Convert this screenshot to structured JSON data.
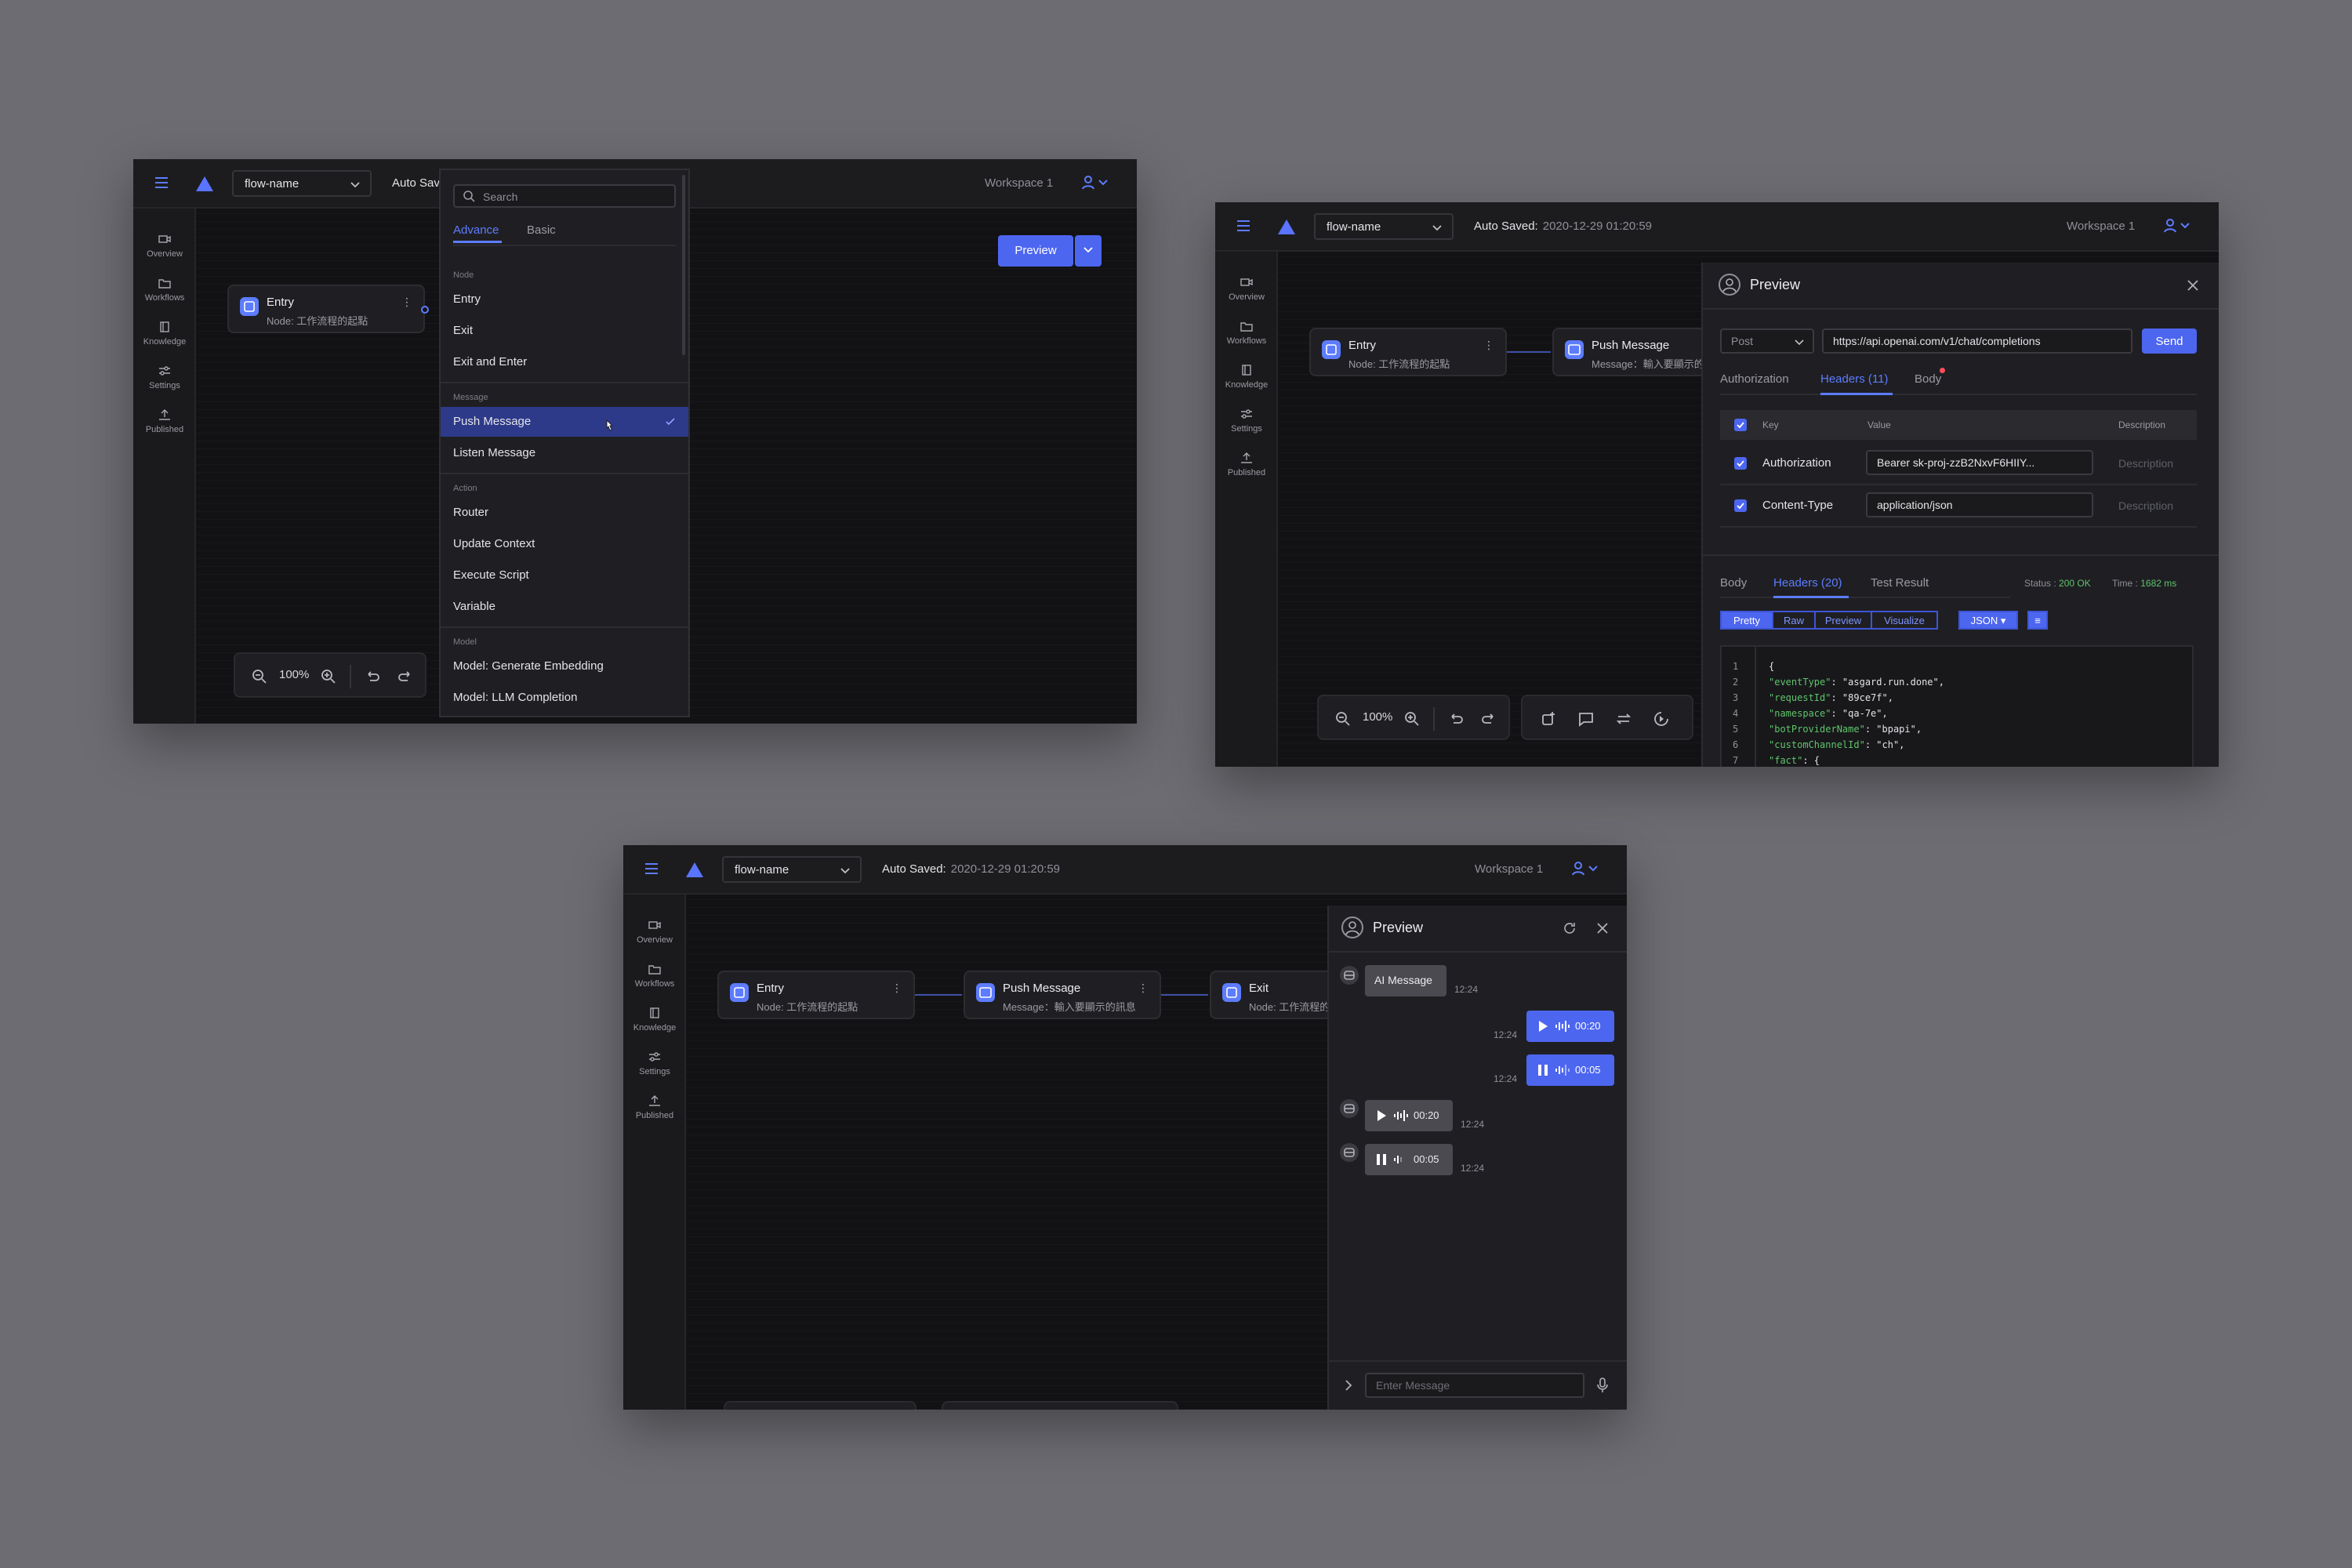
{
  "common": {
    "flow_name": "flow-name",
    "workspace": "Workspace 1",
    "auto_saved_label": "Auto Saved:",
    "auto_saved_time": "2020-12-29 01:20:59",
    "auto_saved_truncated": "Auto Sav",
    "zoom": "100%",
    "sidebar": [
      "Overview",
      "Workflows",
      "Knowledge",
      "Settings",
      "Published"
    ]
  },
  "nodes": {
    "entry": {
      "title": "Entry",
      "sub": "Node: 工作流程的起點"
    },
    "push": {
      "title": "Push Message",
      "sub": "Message：輸入要顯示的訊息",
      "sub_short": "Message：輸入要顯示的"
    },
    "exit": {
      "title": "Exit",
      "sub": "Node: 工作流程的"
    }
  },
  "window1": {
    "preview_button": "Preview",
    "search_placeholder": "Search",
    "tabs": [
      "Advance",
      "Basic"
    ],
    "groups": [
      {
        "label": "Node",
        "items": [
          "Entry",
          "Exit",
          "Exit and Enter"
        ]
      },
      {
        "label": "Message",
        "items": [
          "Push Message",
          "Listen Message"
        ]
      },
      {
        "label": "Action",
        "items": [
          "Router",
          "Update Context",
          "Execute Script",
          "Variable"
        ]
      },
      {
        "label": "Model",
        "items": [
          "Model: Generate Embedding",
          "Model: LLM Completion"
        ]
      }
    ],
    "selected_item": "Push Message"
  },
  "window2": {
    "panel_title": "Preview",
    "method": "Post",
    "url": "https://api.openai.com/v1/chat/completions",
    "send": "Send",
    "req_tabs": [
      "Authorization",
      "Headers (11)",
      "Body"
    ],
    "table_headers": [
      "Key",
      "Value",
      "Description"
    ],
    "rows": [
      {
        "key": "Authorization",
        "value": "Bearer sk-proj-zzB2NxvF6HIIY...",
        "desc": "Description"
      },
      {
        "key": "Content-Type",
        "value": "application/json",
        "desc": "Description"
      }
    ],
    "resp_tabs": [
      "Body",
      "Headers (20)",
      "Test Result"
    ],
    "status_label": "Status :",
    "status_value": "200 OK",
    "time_label": "Time :",
    "time_value": "1682 ms",
    "formats": [
      "Pretty",
      "Raw",
      "Preview",
      "Visualize"
    ],
    "lang": "JSON",
    "code": [
      {
        "n": "1",
        "k": "",
        "v": "{"
      },
      {
        "n": "2",
        "k": "\"eventType\"",
        "v": ": \"asgard.run.done\","
      },
      {
        "n": "3",
        "k": "\"requestId\"",
        "v": ": \"89ce7f\","
      },
      {
        "n": "4",
        "k": "\"namespace\"",
        "v": ": \"qa-7e\","
      },
      {
        "n": "5",
        "k": "\"botProviderName\"",
        "v": ": \"bpapi\","
      },
      {
        "n": "6",
        "k": "\"customChannelId\"",
        "v": ": \"ch\","
      },
      {
        "n": "7",
        "k": "\"fact\"",
        "v": ": {"
      }
    ]
  },
  "window3": {
    "panel_title": "Preview",
    "messages": [
      {
        "from": "bot",
        "text": "AI Message",
        "time": "12:24"
      },
      {
        "from": "me",
        "duration": "00:20",
        "time": "12:24"
      },
      {
        "from": "me",
        "duration": "00:05",
        "time": "12:24"
      },
      {
        "from": "bot",
        "duration": "00:20",
        "time": "12:24"
      },
      {
        "from": "bot",
        "duration": "00:05",
        "time": "12:24"
      }
    ],
    "input_placeholder": "Enter Message"
  },
  "colors": {
    "accent": "#4d66f0",
    "background": "#6d6c72",
    "window": "#141416"
  }
}
